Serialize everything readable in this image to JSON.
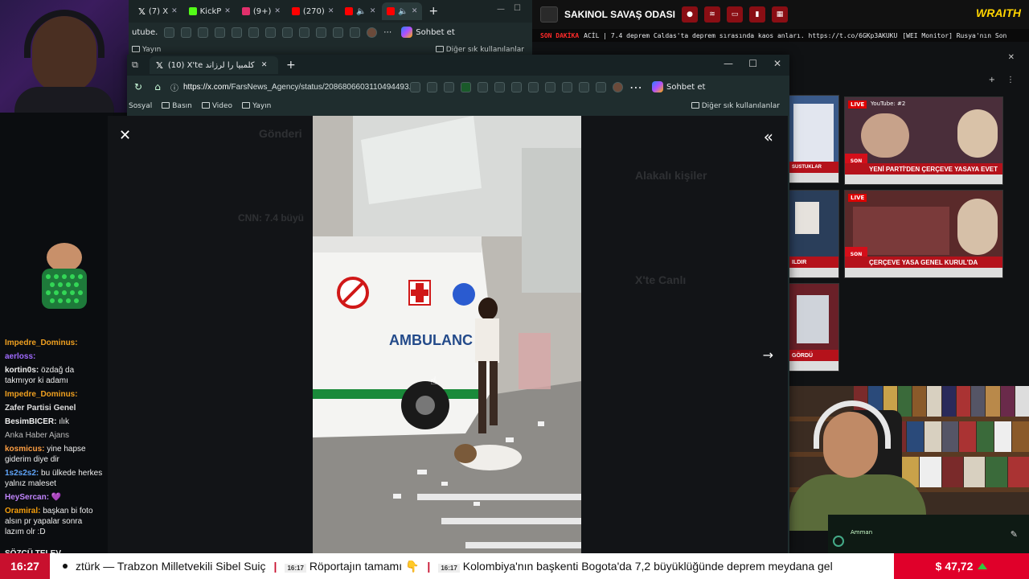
{
  "back_browser": {
    "tabs": [
      "(7) X",
      "KickP",
      "(9+)",
      "(270)",
      "",
      ""
    ],
    "url_partial": "utube.",
    "copilot_label": "Sohbet et",
    "bookmark_left": "Yayın",
    "bookmark_right": "Diğer sık kullanılanlar"
  },
  "dashboard": {
    "title": "SAKINOL SAVAŞ ODASI",
    "brand": "WRAITH",
    "ticker_badge": "SON DAKİKA",
    "ticker_text": "ACİL | 7.4 deprem Caldas'ta deprem sırasında kaos anları. https://t.co/6GKp3AKUKU",
    "ticker_text2": "[WEI Monitor] Rusya'nın Son",
    "tile1_label": "YouTube: #2",
    "tile1_band": "YENİ PARTİ'DEN ÇERÇEVE YASAYA EVET",
    "tile2_band": "ÇERÇEVE YASA GENEL KURUL'DA",
    "tile3_band": "GÖRDÜ",
    "tile_left_text": "SUSTUKLAR",
    "tile_left2_text": "ILDIR",
    "live_label": "LIVE",
    "son_dakika_short": "SON DAKİKA",
    "colors": {
      "red": "#b5121b",
      "brand_yellow": "#ffd400"
    }
  },
  "front_browser": {
    "tab_title": "(10) X'te يشترى غرب كلمبيا را لرزاند ...",
    "url_host": "https://x.com",
    "url_path": "/FarsNews_Agency/status/2086806603110494493...",
    "copilot_label": "Sohbet et",
    "bookmarks": [
      "Sosyal",
      "Basın",
      "Video",
      "Yayın"
    ],
    "bookmark_right": "Diğer sık kullanılanlar"
  },
  "viewer": {
    "bg_texts": [
      "Gönderi",
      "Alakalı kişiler",
      "X'te Canlı",
      "CNN: 7.4 büyü"
    ],
    "ambulance_label": "AMBULANC",
    "icons": [
      "close-icon",
      "collapse-icon",
      "next-arrow-icon"
    ]
  },
  "chat": {
    "lines": [
      {
        "user": "Impedre_Dominus:",
        "msg": "",
        "color": "#f0a020"
      },
      {
        "user": "aerloss:",
        "msg": "",
        "color": "#a06aff"
      },
      {
        "user": "kortin0s:",
        "msg": "özdağ da takmıyor ki adamı",
        "color": "#ffffff"
      },
      {
        "user": "Impedre_Dominus:",
        "msg": "",
        "color": "#f0a020"
      },
      {
        "user": "BesimBICER:",
        "msg": "ılık",
        "color": "#ffffff"
      },
      {
        "user": "kosmicus:",
        "msg": "yine hapse giderim diye dir",
        "color": "#ff9f43"
      },
      {
        "user": "1s2s2s2:",
        "msg": "bu ülkede herkes yalnız maleset",
        "color": "#60a5fa"
      },
      {
        "user": "HeySercan:",
        "msg": "",
        "color": "#c084fc"
      },
      {
        "user": "Oramiral:",
        "msg": "başkan bi foto alsın pr yapalar sonra lazım olr :D",
        "color": "#f59e0b"
      }
    ],
    "overlay_title": "Zafer Partisi Genel",
    "overlay_source": "Anka Haber Ajans",
    "overlay_sozcu": "SÖZCÜ TELEV"
  },
  "ticker": {
    "clock": "16:27",
    "items": [
      {
        "time": "",
        "text": "ztürk — Trabzon Milletvekili Sibel Suiç"
      },
      {
        "time": "16:17",
        "text": "Röportajın tamamı 👇"
      },
      {
        "time": "16:17",
        "text": "Kolombiya'nın başkenti Bogota'da 7,2 büyüklüğünde deprem meydana gel"
      }
    ],
    "usd": "$ 47,72"
  },
  "map": {
    "label": "Amman"
  }
}
